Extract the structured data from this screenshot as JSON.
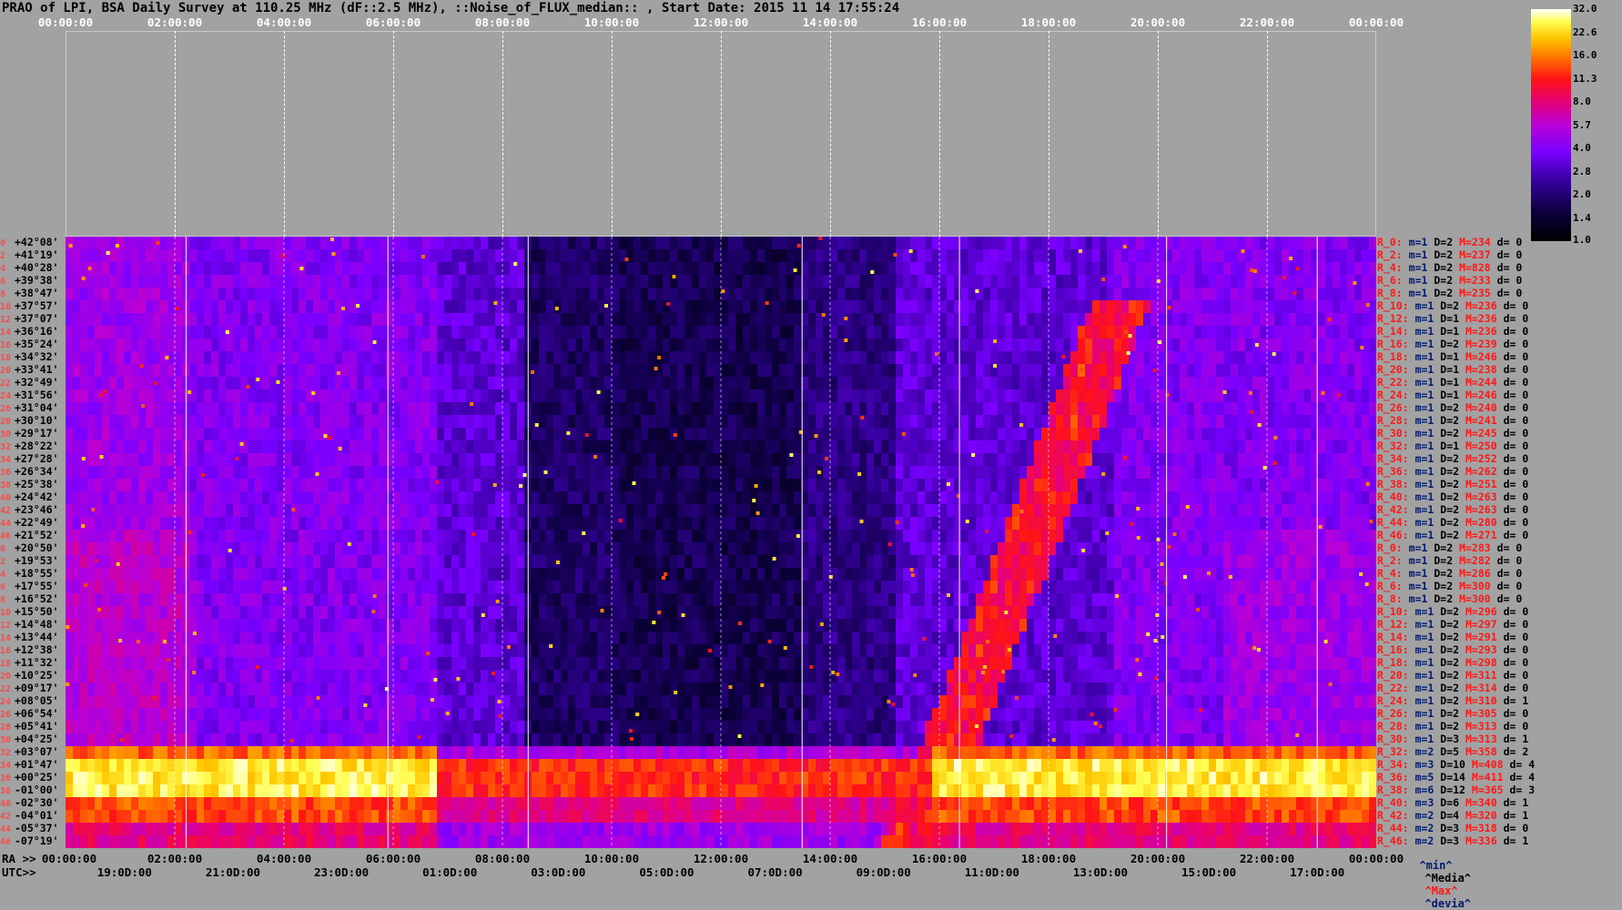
{
  "title": "PRAO of LPI, BSA Daily Survey at 110.25 MHz (dF::2.5 MHz), ::Noise_of_FLUX_median:: , Start Date: 2015 11 14 17:55:24",
  "chart_data": {
    "type": "heatmap",
    "title": "PRAO of LPI, BSA Daily Survey at 110.25 MHz (dF::2.5 MHz), ::Noise_of_FLUX_median:: , Start Date: 2015 11 14 17:55:24",
    "x_top_ticks": [
      "00:00:00",
      "02:00:00",
      "04:00:00",
      "06:00:00",
      "08:00:00",
      "10:00:00",
      "12:00:00",
      "14:00:00",
      "16:00:00",
      "18:00:00",
      "20:00:00",
      "22:00:00",
      "00:00:00"
    ],
    "ra_axis_prefix": "RA >>",
    "ra_ticks": [
      "00:00:00",
      "02:00:00",
      "04:00:00",
      "06:00:00",
      "08:00:00",
      "10:00:00",
      "12:00:00",
      "14:00:00",
      "16:00:00",
      "18:00:00",
      "20:00:00",
      "22:00:00",
      "00:00:00"
    ],
    "utc_axis_prefix": "UTC>>",
    "utc_ticks": [
      "19:0D:00",
      "21:0D:00",
      "23:0D:00",
      "01:0D:00",
      "03:0D:00",
      "05:0D:00",
      "07:0D:00",
      "09:0D:00",
      "11:0D:00",
      "13:0D:00",
      "15:0D:00",
      "17:0D:00"
    ],
    "colorbar": {
      "ticks": [
        "32.0",
        "22.6",
        "16.0",
        "11.3",
        "8.0",
        "5.7",
        "4.0",
        "2.8",
        "2.0",
        "1.4",
        "1.0"
      ],
      "scale": "log",
      "colors": [
        "#fffff2",
        "#ffff55",
        "#ffc800",
        "#ff7a00",
        "#ff1414",
        "#e0007a",
        "#b000d8",
        "#7a00ff",
        "#2a00a0",
        "#080030",
        "#000000"
      ]
    },
    "rows": [
      {
        "n": "0",
        "dec": "+42°08'",
        "r": "R_0:",
        "m": "m=1",
        "D": "D=2",
        "M": "M=234",
        "d": "d= 0"
      },
      {
        "n": "2",
        "dec": "+41°19'",
        "r": "R_2:",
        "m": "m=1",
        "D": "D=2",
        "M": "M=237",
        "d": "d= 0"
      },
      {
        "n": "4",
        "dec": "+40°28'",
        "r": "R_4:",
        "m": "m=1",
        "D": "D=2",
        "M": "M=828",
        "d": "d= 0"
      },
      {
        "n": "6",
        "dec": "+39°38'",
        "r": "R_6:",
        "m": "m=1",
        "D": "D=2",
        "M": "M=233",
        "d": "d= 0"
      },
      {
        "n": "8",
        "dec": "+38°47'",
        "r": "R_8:",
        "m": "m=1",
        "D": "D=2",
        "M": "M=235",
        "d": "d= 0"
      },
      {
        "n": "10",
        "dec": "+37°57'",
        "r": "R_10:",
        "m": "m=1",
        "D": "D=2",
        "M": "M=236",
        "d": "d= 0"
      },
      {
        "n": "12",
        "dec": "+37°07'",
        "r": "R_12:",
        "m": "m=1",
        "D": "D=1",
        "M": "M=236",
        "d": "d= 0"
      },
      {
        "n": "14",
        "dec": "+36°16'",
        "r": "R_14:",
        "m": "m=1",
        "D": "D=1",
        "M": "M=236",
        "d": "d= 0"
      },
      {
        "n": "16",
        "dec": "+35°24'",
        "r": "R_16:",
        "m": "m=1",
        "D": "D=2",
        "M": "M=239",
        "d": "d= 0"
      },
      {
        "n": "18",
        "dec": "+34°32'",
        "r": "R_18:",
        "m": "m=1",
        "D": "D=1",
        "M": "M=246",
        "d": "d= 0"
      },
      {
        "n": "20",
        "dec": "+33°41'",
        "r": "R_20:",
        "m": "m=1",
        "D": "D=1",
        "M": "M=238",
        "d": "d= 0"
      },
      {
        "n": "22",
        "dec": "+32°49'",
        "r": "R_22:",
        "m": "m=1",
        "D": "D=1",
        "M": "M=244",
        "d": "d= 0"
      },
      {
        "n": "24",
        "dec": "+31°56'",
        "r": "R_24:",
        "m": "m=1",
        "D": "D=1",
        "M": "M=246",
        "d": "d= 0"
      },
      {
        "n": "26",
        "dec": "+31°04'",
        "r": "R_26:",
        "m": "m=1",
        "D": "D=2",
        "M": "M=240",
        "d": "d= 0"
      },
      {
        "n": "28",
        "dec": "+30°10'",
        "r": "R_28:",
        "m": "m=1",
        "D": "D=2",
        "M": "M=241",
        "d": "d= 0"
      },
      {
        "n": "30",
        "dec": "+29°17'",
        "r": "R_30:",
        "m": "m=1",
        "D": "D=2",
        "M": "M=245",
        "d": "d= 0"
      },
      {
        "n": "32",
        "dec": "+28°22'",
        "r": "R_32:",
        "m": "m=1",
        "D": "D=1",
        "M": "M=250",
        "d": "d= 0"
      },
      {
        "n": "34",
        "dec": "+27°28'",
        "r": "R_34:",
        "m": "m=1",
        "D": "D=2",
        "M": "M=252",
        "d": "d= 0"
      },
      {
        "n": "36",
        "dec": "+26°34'",
        "r": "R_36:",
        "m": "m=1",
        "D": "D=2",
        "M": "M=262",
        "d": "d= 0"
      },
      {
        "n": "38",
        "dec": "+25°38'",
        "r": "R_38:",
        "m": "m=1",
        "D": "D=2",
        "M": "M=251",
        "d": "d= 0"
      },
      {
        "n": "40",
        "dec": "+24°42'",
        "r": "R_40:",
        "m": "m=1",
        "D": "D=2",
        "M": "M=263",
        "d": "d= 0"
      },
      {
        "n": "42",
        "dec": "+23°46'",
        "r": "R_42:",
        "m": "m=1",
        "D": "D=2",
        "M": "M=263",
        "d": "d= 0"
      },
      {
        "n": "44",
        "dec": "+22°49'",
        "r": "R_44:",
        "m": "m=1",
        "D": "D=2",
        "M": "M=280",
        "d": "d= 0"
      },
      {
        "n": "46",
        "dec": "+21°52'",
        "r": "R_46:",
        "m": "m=1",
        "D": "D=2",
        "M": "M=271",
        "d": "d= 0"
      },
      {
        "n": "0",
        "dec": "+20°50'",
        "r": "R_0:",
        "m": "m=1",
        "D": "D=2",
        "M": "M=283",
        "d": "d= 0"
      },
      {
        "n": "2",
        "dec": "+19°53'",
        "r": "R_2:",
        "m": "m=1",
        "D": "D=2",
        "M": "M=282",
        "d": "d= 0"
      },
      {
        "n": "4",
        "dec": "+18°55'",
        "r": "R_4:",
        "m": "m=1",
        "D": "D=2",
        "M": "M=286",
        "d": "d= 0"
      },
      {
        "n": "6",
        "dec": "+17°55'",
        "r": "R_6:",
        "m": "m=1",
        "D": "D=2",
        "M": "M=300",
        "d": "d= 0"
      },
      {
        "n": "8",
        "dec": "+16°52'",
        "r": "R_8:",
        "m": "m=1",
        "D": "D=2",
        "M": "M=300",
        "d": "d= 0"
      },
      {
        "n": "10",
        "dec": "+15°50'",
        "r": "R_10:",
        "m": "m=1",
        "D": "D=2",
        "M": "M=296",
        "d": "d= 0"
      },
      {
        "n": "12",
        "dec": "+14°48'",
        "r": "R_12:",
        "m": "m=1",
        "D": "D=2",
        "M": "M=297",
        "d": "d= 0"
      },
      {
        "n": "14",
        "dec": "+13°44'",
        "r": "R_14:",
        "m": "m=1",
        "D": "D=2",
        "M": "M=291",
        "d": "d= 0"
      },
      {
        "n": "16",
        "dec": "+12°38'",
        "r": "R_16:",
        "m": "m=1",
        "D": "D=2",
        "M": "M=293",
        "d": "d= 0"
      },
      {
        "n": "18",
        "dec": "+11°32'",
        "r": "R_18:",
        "m": "m=1",
        "D": "D=2",
        "M": "M=298",
        "d": "d= 0"
      },
      {
        "n": "20",
        "dec": "+10°25'",
        "r": "R_20:",
        "m": "m=1",
        "D": "D=2",
        "M": "M=311",
        "d": "d= 0"
      },
      {
        "n": "22",
        "dec": "+09°17'",
        "r": "R_22:",
        "m": "m=1",
        "D": "D=2",
        "M": "M=314",
        "d": "d= 0"
      },
      {
        "n": "24",
        "dec": "+08°05'",
        "r": "R_24:",
        "m": "m=1",
        "D": "D=2",
        "M": "M=310",
        "d": "d= 1"
      },
      {
        "n": "26",
        "dec": "+06°54'",
        "r": "R_26:",
        "m": "m=1",
        "D": "D=2",
        "M": "M=305",
        "d": "d= 0"
      },
      {
        "n": "28",
        "dec": "+05°41'",
        "r": "R_28:",
        "m": "m=1",
        "D": "D=2",
        "M": "M=313",
        "d": "d= 0"
      },
      {
        "n": "30",
        "dec": "+04°25'",
        "r": "R_30:",
        "m": "m=1",
        "D": "D=3",
        "M": "M=313",
        "d": "d= 1"
      },
      {
        "n": "32",
        "dec": "+03°07'",
        "r": "R_32:",
        "m": "m=2",
        "D": "D=5",
        "M": "M=358",
        "d": "d= 2"
      },
      {
        "n": "34",
        "dec": "+01°47'",
        "r": "R_34:",
        "m": "m=3",
        "D": "D=10",
        "M": "M=408",
        "d": "d= 4"
      },
      {
        "n": "36",
        "dec": "+00°25'",
        "r": "R_36:",
        "m": "m=5",
        "D": "D=14",
        "M": "M=411",
        "d": "d= 4"
      },
      {
        "n": "38",
        "dec": "-01°00'",
        "r": "R_38:",
        "m": "m=6",
        "D": "D=12",
        "M": "M=365",
        "d": "d= 3"
      },
      {
        "n": "40",
        "dec": "-02°30'",
        "r": "R_40:",
        "m": "m=3",
        "D": "D=6",
        "M": "M=340",
        "d": "d= 1"
      },
      {
        "n": "42",
        "dec": "-04°01'",
        "r": "R_42:",
        "m": "m=2",
        "D": "D=4",
        "M": "M=320",
        "d": "d= 1"
      },
      {
        "n": "44",
        "dec": "-05°37'",
        "r": "R_44:",
        "m": "m=2",
        "D": "D=3",
        "M": "M=318",
        "d": "d= 0"
      },
      {
        "n": "46",
        "dec": "-07°19'",
        "r": "R_46:",
        "m": "m=2",
        "D": "D=3",
        "M": "M=336",
        "d": "d= 1"
      }
    ]
  },
  "legend": {
    "min": "^min^",
    "media": "^Media^",
    "max": "^Max^",
    "devia": "^devia^",
    "min_color": "#001a6e",
    "max_color": "#ff1818"
  }
}
